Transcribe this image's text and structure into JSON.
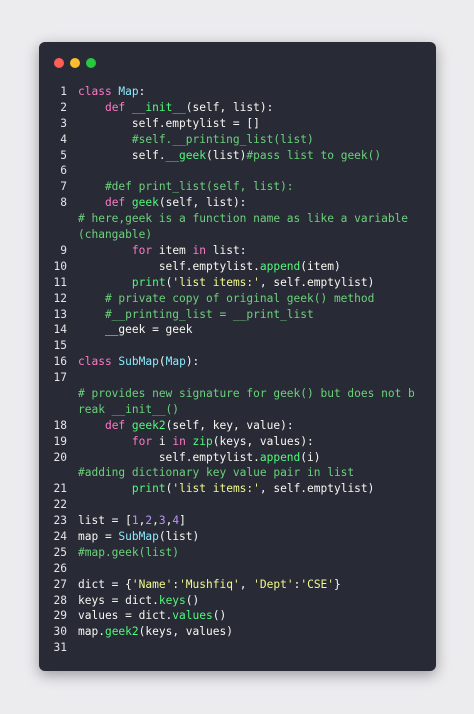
{
  "window": {
    "controls": [
      "close",
      "minimize",
      "maximize"
    ]
  },
  "code": {
    "lines": [
      {
        "num": "1",
        "segments": [
          [
            "k",
            "class "
          ],
          [
            "cls",
            "Map"
          ],
          [
            "p",
            ":"
          ]
        ]
      },
      {
        "num": "2",
        "segments": [
          [
            "p",
            "    "
          ],
          [
            "k",
            "def "
          ],
          [
            "f",
            "__init__"
          ],
          [
            "p",
            "(self, list):"
          ]
        ]
      },
      {
        "num": "3",
        "segments": [
          [
            "p",
            "        self.emptylist = []"
          ]
        ]
      },
      {
        "num": "4",
        "segments": [
          [
            "cm",
            "        #self.__printing_list(list)"
          ]
        ]
      },
      {
        "num": "5",
        "segments": [
          [
            "p",
            "        self."
          ],
          [
            "f",
            "__geek"
          ],
          [
            "p",
            "(list)"
          ],
          [
            "cm",
            "#pass list to geek()"
          ]
        ]
      },
      {
        "num": "6",
        "segments": [
          [
            "p",
            ""
          ]
        ]
      },
      {
        "num": "7",
        "segments": [
          [
            "cm",
            "    #def print_list(self, list):"
          ]
        ]
      },
      {
        "num": "8",
        "segments": [
          [
            "p",
            "    "
          ],
          [
            "k",
            "def "
          ],
          [
            "f",
            "geek"
          ],
          [
            "p",
            "(self, list):"
          ]
        ]
      },
      {
        "num": "",
        "wrap": true,
        "segments": [
          [
            "cm",
            "# here,geek is a function name as like a variable(changable)"
          ]
        ]
      },
      {
        "num": "9",
        "segments": [
          [
            "p",
            "        "
          ],
          [
            "k",
            "for "
          ],
          [
            "p",
            "item "
          ],
          [
            "k",
            "in "
          ],
          [
            "p",
            "list:"
          ]
        ]
      },
      {
        "num": "10",
        "segments": [
          [
            "p",
            "            self.emptylist."
          ],
          [
            "f",
            "append"
          ],
          [
            "p",
            "(item)"
          ]
        ]
      },
      {
        "num": "11",
        "segments": [
          [
            "p",
            "        "
          ],
          [
            "f",
            "print"
          ],
          [
            "p",
            "("
          ],
          [
            "s",
            "'list items:'"
          ],
          [
            "p",
            ", self.emptylist)"
          ]
        ]
      },
      {
        "num": "12",
        "segments": [
          [
            "cm",
            "    # private copy of original geek() method"
          ]
        ]
      },
      {
        "num": "13",
        "segments": [
          [
            "cm",
            "    #__printing_list = __print_list"
          ]
        ]
      },
      {
        "num": "14",
        "segments": [
          [
            "p",
            "    __geek = geek"
          ]
        ]
      },
      {
        "num": "15",
        "segments": [
          [
            "p",
            ""
          ]
        ]
      },
      {
        "num": "16",
        "segments": [
          [
            "k",
            "class "
          ],
          [
            "cls",
            "SubMap"
          ],
          [
            "p",
            "("
          ],
          [
            "cls",
            "Map"
          ],
          [
            "p",
            "):"
          ]
        ]
      },
      {
        "num": "17",
        "segments": [
          [
            "p",
            ""
          ]
        ]
      },
      {
        "num": "",
        "wrap": true,
        "segments": [
          [
            "cm",
            "# provides new signature for geek() but does not break __init__()"
          ]
        ]
      },
      {
        "num": "18",
        "segments": [
          [
            "p",
            "    "
          ],
          [
            "k",
            "def "
          ],
          [
            "f",
            "geek2"
          ],
          [
            "p",
            "(self, key, value):"
          ]
        ]
      },
      {
        "num": "19",
        "segments": [
          [
            "p",
            "        "
          ],
          [
            "k",
            "for "
          ],
          [
            "p",
            "i "
          ],
          [
            "k",
            "in "
          ],
          [
            "f",
            "zip"
          ],
          [
            "p",
            "(keys, values):"
          ]
        ]
      },
      {
        "num": "20",
        "segments": [
          [
            "p",
            "            self.emptylist."
          ],
          [
            "f",
            "append"
          ],
          [
            "p",
            "(i)"
          ]
        ]
      },
      {
        "num": "",
        "segments": [
          [
            "cm",
            "#adding dictionary key value pair in list"
          ]
        ]
      },
      {
        "num": "21",
        "segments": [
          [
            "p",
            "        "
          ],
          [
            "f",
            "print"
          ],
          [
            "p",
            "("
          ],
          [
            "s",
            "'list items:'"
          ],
          [
            "p",
            ", self.emptylist)"
          ]
        ]
      },
      {
        "num": "22",
        "segments": [
          [
            "p",
            ""
          ]
        ]
      },
      {
        "num": "23",
        "segments": [
          [
            "p",
            "list = ["
          ],
          [
            "n",
            "1"
          ],
          [
            "p",
            ","
          ],
          [
            "n",
            "2"
          ],
          [
            "p",
            ","
          ],
          [
            "n",
            "3"
          ],
          [
            "p",
            ","
          ],
          [
            "n",
            "4"
          ],
          [
            "p",
            "]"
          ]
        ]
      },
      {
        "num": "24",
        "segments": [
          [
            "p",
            "map = "
          ],
          [
            "cls",
            "SubMap"
          ],
          [
            "p",
            "(list)"
          ]
        ]
      },
      {
        "num": "25",
        "segments": [
          [
            "cm",
            "#map.geek(list)"
          ]
        ]
      },
      {
        "num": "26",
        "segments": [
          [
            "p",
            ""
          ]
        ]
      },
      {
        "num": "27",
        "segments": [
          [
            "p",
            "dict = {"
          ],
          [
            "s",
            "'Name'"
          ],
          [
            "p",
            ":"
          ],
          [
            "s",
            "'Mushfiq'"
          ],
          [
            "p",
            ", "
          ],
          [
            "s",
            "'Dept'"
          ],
          [
            "p",
            ":"
          ],
          [
            "s",
            "'CSE'"
          ],
          [
            "p",
            "}"
          ]
        ]
      },
      {
        "num": "28",
        "segments": [
          [
            "p",
            "keys = dict."
          ],
          [
            "f",
            "keys"
          ],
          [
            "p",
            "()"
          ]
        ]
      },
      {
        "num": "29",
        "segments": [
          [
            "p",
            "values = dict."
          ],
          [
            "f",
            "values"
          ],
          [
            "p",
            "()"
          ]
        ]
      },
      {
        "num": "30",
        "segments": [
          [
            "p",
            "map."
          ],
          [
            "f",
            "geek2"
          ],
          [
            "p",
            "(keys, values)"
          ]
        ]
      },
      {
        "num": "31",
        "segments": [
          [
            "p",
            ""
          ]
        ]
      }
    ]
  }
}
